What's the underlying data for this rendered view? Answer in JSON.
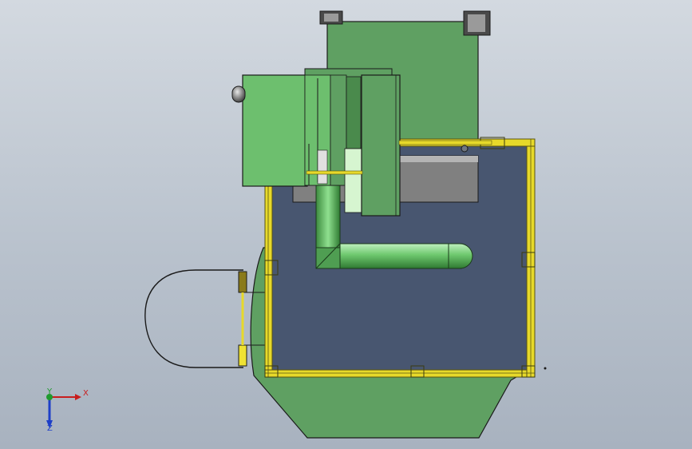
{
  "viewport": {
    "background_top": "#d3d9e0",
    "background_bottom": "#a8b2bf"
  },
  "model": {
    "colors": {
      "frame": "#e7d92a",
      "frame_edge": "#5a5410",
      "panel": "#485670",
      "green": "#5fa062",
      "green_light": "#6dbf6e",
      "edge": "#1a1a1a",
      "tray": "#808080"
    }
  },
  "triad": {
    "x_label": "X",
    "y_label": "Y",
    "z_label": "Z",
    "x_color": "#c81e1e",
    "y_color": "#1f9a2e",
    "z_color": "#1e3fc8"
  }
}
